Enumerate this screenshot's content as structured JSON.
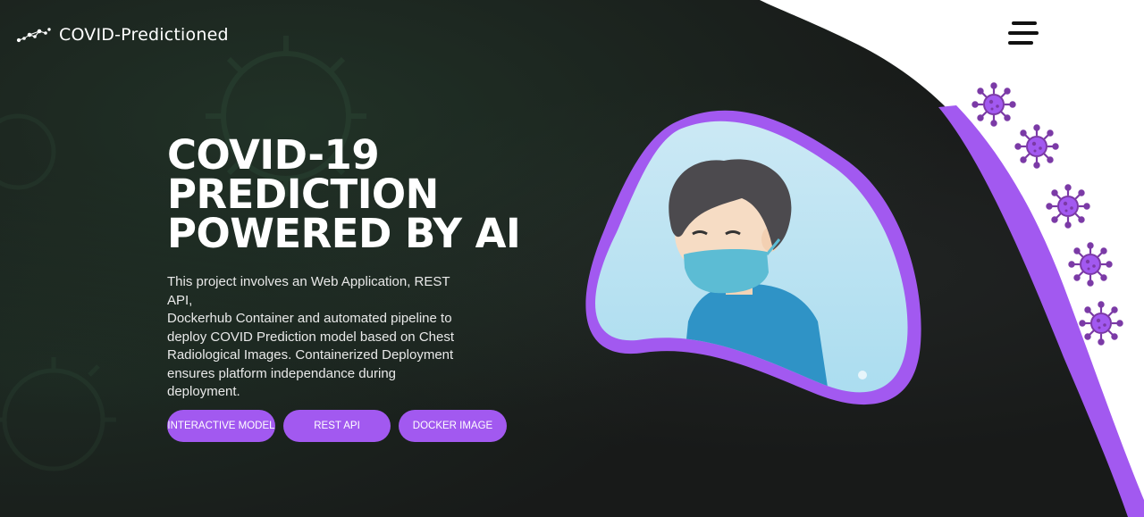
{
  "header": {
    "brand": "COVID-Predictioned",
    "logo_icon": "network-dots-icon",
    "menu_icon": "hamburger-menu-icon"
  },
  "hero": {
    "title_lines": [
      "COVID-19",
      "PREDICTION",
      "POWERED BY AI"
    ],
    "description_lines": [
      "This project involves an Web Application, REST API,",
      "Dockerhub Container and automated pipeline to",
      "deploy COVID Prediction model based on Chest",
      "Radiological Images. Containerized Deployment",
      "ensures platform independance during",
      "deployment."
    ]
  },
  "buttons": {
    "interactive_model": "INTERACTIVE MODEL",
    "rest_api": "REST API",
    "docker_image": "DOCKER IMAGE"
  },
  "illustration": {
    "subject": "masked-boy-illustration",
    "virus_icon": "virus-icon",
    "virus_count": 5
  },
  "colors": {
    "accent": "#a259f0",
    "background": "#181a19",
    "panel": "#ffffff",
    "text": "#ffffff"
  }
}
